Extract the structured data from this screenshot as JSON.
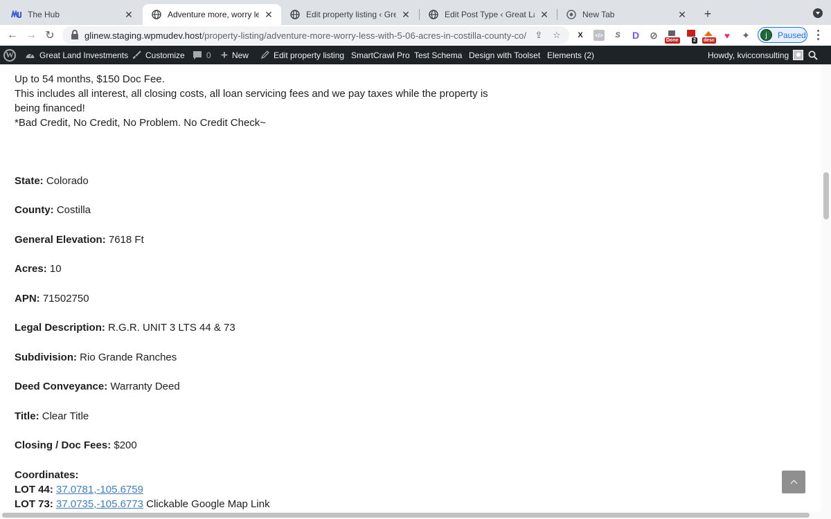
{
  "tabs": [
    {
      "title": "The Hub",
      "icon": "wpmudev-icon"
    },
    {
      "title": "Adventure more, worry less wi",
      "icon": "globe-icon"
    },
    {
      "title": "Edit property listing ‹ Great La",
      "icon": "globe-icon"
    },
    {
      "title": "Edit Post Type ‹ Great Land Inv",
      "icon": "globe-icon"
    },
    {
      "title": "New Tab",
      "icon": "chrome-icon"
    }
  ],
  "address": {
    "host": "glinew.staging.wpmudev.host",
    "path": "/property-listing/adventure-more-worry-less-with-5-06-acres-in-costilla-county-co/"
  },
  "extensions": {
    "badge_done": "Done",
    "badge_count": "2",
    "badge_desc": "desc"
  },
  "profile": {
    "initial": "j",
    "status": "Paused"
  },
  "admin_bar": {
    "site_name": "Great Land Investments",
    "customize": "Customize",
    "comments_count": "0",
    "new": "New",
    "edit": "Edit property listing",
    "smartcrawl": "SmartCrawl Pro",
    "test_schema": "Test Schema",
    "toolset": "Design with Toolset",
    "elements": "Elements (2)",
    "howdy": "Howdy, kvicconsulting"
  },
  "content": {
    "intro_line1": "Up to 54 months, $150 Doc Fee.",
    "intro_line2": "This includes all interest, all closing costs, all loan servicing fees and we pay taxes while the property is being financed!",
    "intro_line3": "*Bad Credit, No Credit, No Problem. No Credit Check~",
    "fields": [
      {
        "label": "State:",
        "value": "Colorado"
      },
      {
        "label": "County:",
        "value": "Costilla"
      },
      {
        "label": "General Elevation:",
        "value": "7618 Ft"
      },
      {
        "label": "Acres:",
        "value": "10"
      },
      {
        "label": "APN:",
        "value": "71502750"
      },
      {
        "label": "Legal Description:",
        "value": "R.G.R. UNIT 3 LTS 44 & 73"
      },
      {
        "label": "Subdivision:",
        "value": "Rio Grande Ranches"
      },
      {
        "label": "Deed Conveyance:",
        "value": "Warranty Deed"
      },
      {
        "label": "Title:",
        "value": "Clear Title"
      },
      {
        "label": "Closing / Doc Fees:",
        "value": "$200"
      }
    ],
    "coordinates_label": "Coordinates:",
    "lot44_label": "LOT 44:",
    "lot44_link": "37.0781,-105.6759",
    "lot73_label": "LOT 73:",
    "lot73_link": "37.0735,-105.6773",
    "map_link_note": "Clickable Google Map Link"
  }
}
